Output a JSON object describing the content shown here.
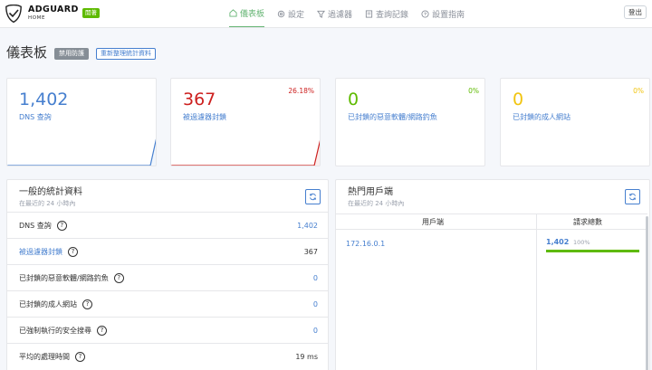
{
  "header": {
    "brand": "ADGUARD",
    "brand_sub": "HOME",
    "status": "開著",
    "nav": [
      {
        "label": "儀表板",
        "icon": "dashboard-icon",
        "active": true
      },
      {
        "label": "設定",
        "icon": "gear-icon",
        "active": false
      },
      {
        "label": "過濾器",
        "icon": "filter-icon",
        "active": false
      },
      {
        "label": "查詢記錄",
        "icon": "log-icon",
        "active": false
      },
      {
        "label": "設置指南",
        "icon": "help-icon",
        "active": false
      }
    ],
    "logout": "登出",
    "accent": "#66b574"
  },
  "page": {
    "title": "儀表板",
    "disable_btn": "禁用防護",
    "refresh_stats_btn": "重新整理統計資料"
  },
  "cards": [
    {
      "value": "1,402",
      "label": "DNS 查詢",
      "pct": "",
      "color": "#467fcf"
    },
    {
      "value": "367",
      "label": "被過濾器封鎖",
      "pct": "26.18%",
      "color": "#cd201f"
    },
    {
      "value": "0",
      "label": "已封鎖的惡意軟體/網路釣魚",
      "pct": "0%",
      "color": "#5eba00"
    },
    {
      "value": "0",
      "label": "已封鎖的成人網站",
      "pct": "0%",
      "color": "#f1c40f"
    }
  ],
  "general": {
    "title": "一般的統計資料",
    "subtitle": "在最近的 24 小時內",
    "rows": [
      {
        "label": "DNS 查詢",
        "value": "1,402"
      },
      {
        "label": "被過濾器封鎖",
        "value": "367"
      },
      {
        "label": "已封鎖的惡意軟體/網路釣魚",
        "value": "0"
      },
      {
        "label": "已封鎖的成人網站",
        "value": "0"
      },
      {
        "label": "已強制執行的安全搜尋",
        "value": "0"
      },
      {
        "label": "平均的處理時間",
        "value": "19 ms"
      }
    ]
  },
  "clients": {
    "title": "熱門用戶端",
    "subtitle": "在最近的 24 小時內",
    "col_client": "用戶端",
    "col_requests": "請求總數",
    "rows": [
      {
        "client": "172.16.0.1",
        "count": "1,402",
        "pct": "100%",
        "fraction": 1.0
      }
    ]
  }
}
